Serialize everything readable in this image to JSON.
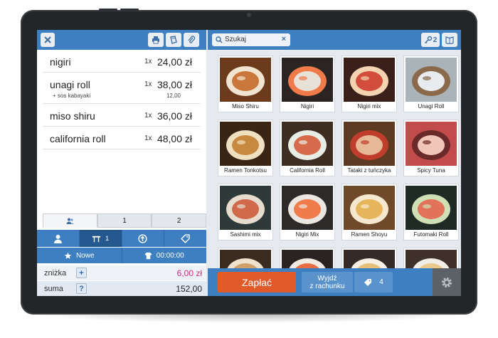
{
  "order": {
    "items": [
      {
        "name": "nigiri",
        "qty": "1x",
        "price": "24,00 zł"
      },
      {
        "name": "unagi roll",
        "qty": "1x",
        "price": "38,00 zł",
        "modifier": "+ sos kabayaki",
        "modifier_price": "12,00"
      },
      {
        "name": "miso shiru",
        "qty": "1x",
        "price": "36,00 zł"
      },
      {
        "name": "california roll",
        "qty": "1x",
        "price": "48,00 zł"
      }
    ],
    "tabs": [
      "",
      "1",
      "2"
    ]
  },
  "actions": {
    "table_label": "1",
    "new_label": "Nowe",
    "timer": "00:00:00"
  },
  "totals": {
    "discount_label": "zniżka",
    "discount_btn": "+",
    "discount_value": "6,00 zł",
    "sum_label": "suma",
    "sum_btn": "?",
    "sum_value": "152,00"
  },
  "search": {
    "query": "Szukaj",
    "clear": "×"
  },
  "header_right": {
    "key_count": "2"
  },
  "products": [
    {
      "name": "Miso Shiru",
      "icon": "soup-image"
    },
    {
      "name": "Nigiri",
      "icon": "nigiri-image"
    },
    {
      "name": "Nigiri mix",
      "icon": "nigiri-mix-image"
    },
    {
      "name": "Unagi Roll",
      "icon": "roll-image"
    },
    {
      "name": "Ramen Tonkotsu",
      "icon": "ramen-image"
    },
    {
      "name": "California Roll",
      "icon": "roll-image"
    },
    {
      "name": "Tataki z tuńczyka",
      "icon": "tataki-image"
    },
    {
      "name": "Spicy Tuna",
      "icon": "tuna-image"
    },
    {
      "name": "Sashimi mix",
      "icon": "sashimi-image"
    },
    {
      "name": "Nigiri Mix",
      "icon": "nigiri-mix-image"
    },
    {
      "name": "Ramen Shoyu",
      "icon": "ramen-image"
    },
    {
      "name": "Futomaki Roll",
      "icon": "futomaki-image"
    },
    {
      "name": "",
      "icon": "food-image"
    },
    {
      "name": "",
      "icon": "food-image"
    },
    {
      "name": "",
      "icon": "food-image"
    },
    {
      "name": "",
      "icon": "food-image"
    }
  ],
  "bottom": {
    "pay_label": "Zapłać",
    "exit_label_1": "Wyjdź",
    "exit_label_2": "z rachunku",
    "split_count": "4"
  },
  "colors": {
    "accent": "#3d7fc1",
    "pay": "#e05a2a",
    "discount": "#c8307d",
    "bezel": "#232629"
  }
}
